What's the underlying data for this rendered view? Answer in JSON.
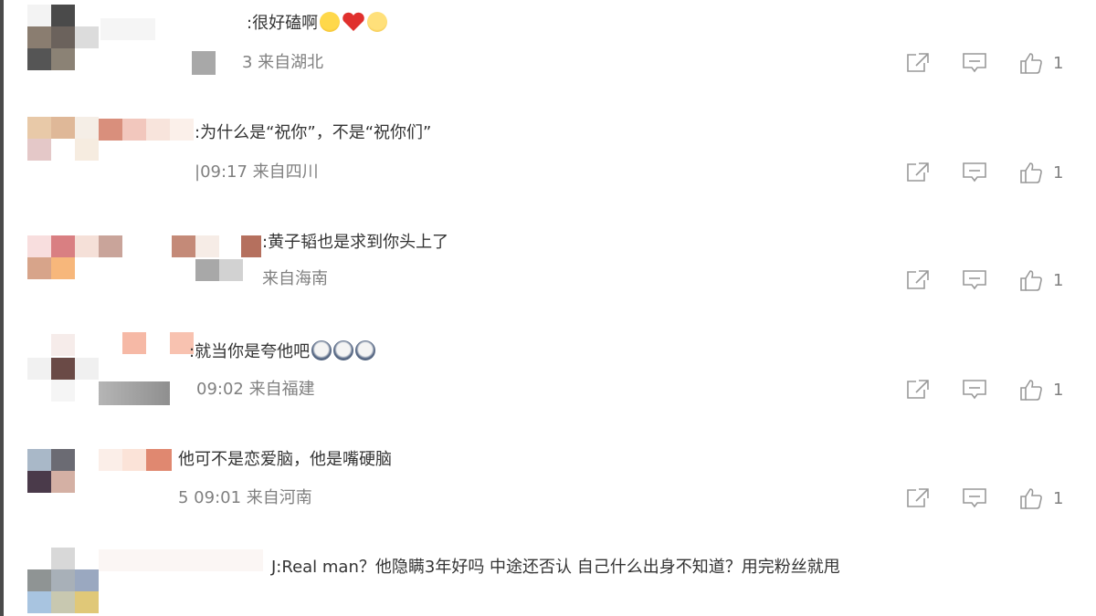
{
  "comments": [
    {
      "text": ":很好磕啊",
      "meta": "3 来自湖北",
      "likes": "1",
      "emoji": [
        "crying-laugh-emoji-icon",
        "red-heart-icon",
        "crying-face-emoji-icon"
      ]
    },
    {
      "text": ":为什么是“祝你”，不是“祝你们”",
      "meta": "|09:17 来自四川",
      "likes": "1",
      "emoji": []
    },
    {
      "text": ":黄子韬也是求到你头上了",
      "meta": "来自海南",
      "likes": "1",
      "emoji": []
    },
    {
      "text": ":就当你是夸他吧",
      "meta": "09:02 来自福建",
      "likes": "1",
      "emoji": [
        "crying-emoji-icon",
        "crying-emoji-icon",
        "crying-emoji-icon"
      ]
    },
    {
      "text": "他可不是恋爱脑，他是嘴硬脑",
      "meta": "5 09:01 来自河南",
      "likes": "1",
      "emoji": []
    },
    {
      "text": "J:Real  man？他隐瞒3年好吗 中途还否认  自己什么出身不知道？用完粉丝就甩",
      "meta": "",
      "likes": "",
      "emoji": []
    }
  ],
  "colors": {
    "text": "#333333",
    "meta": "#808080",
    "icon": "#999999",
    "heart": "#e0302d"
  }
}
